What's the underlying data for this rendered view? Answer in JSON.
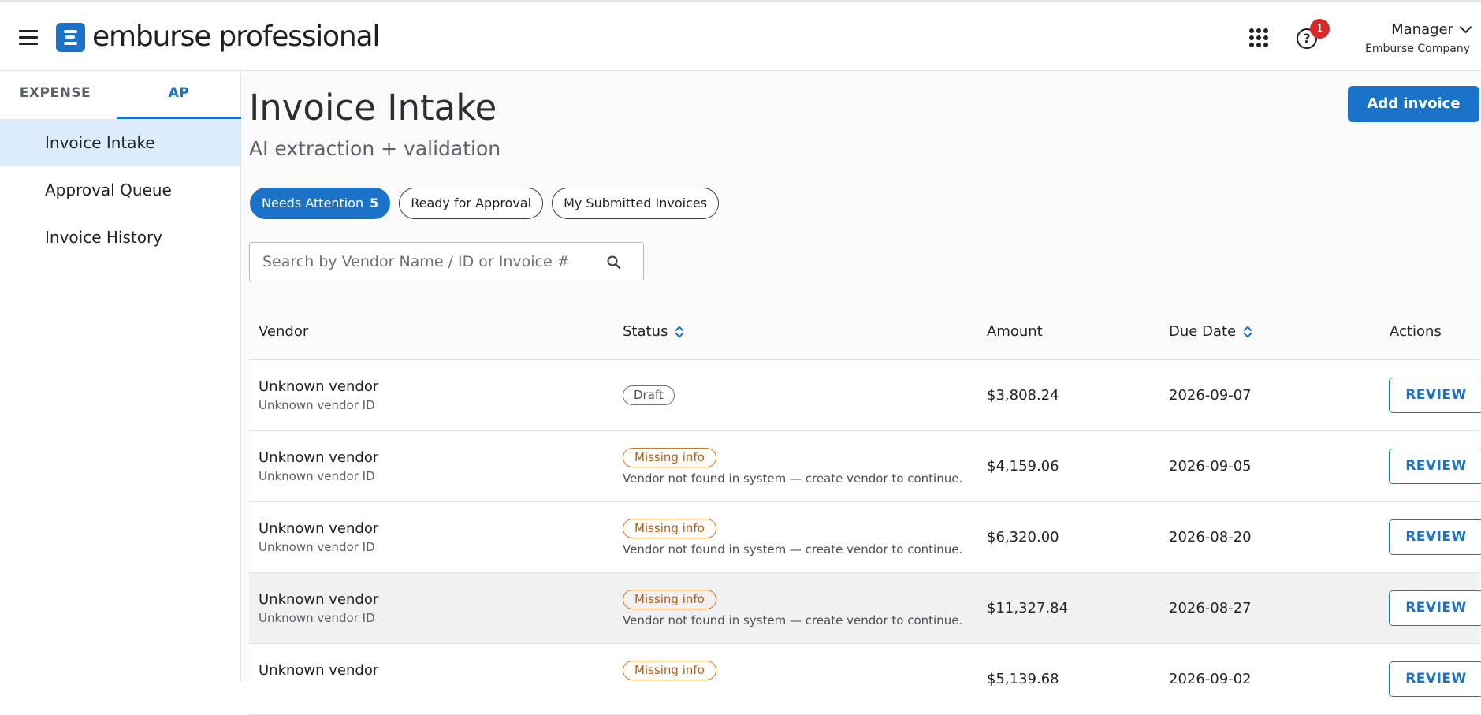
{
  "header": {
    "logo_text": "emburse professional",
    "help_badge_count": "1",
    "user_name": "Manager",
    "user_company": "Emburse Company",
    "help_icon": "help-icon",
    "apps_icon": "apps-grid-icon"
  },
  "sidebar": {
    "tabs": [
      {
        "label": "EXPENSE",
        "active": false
      },
      {
        "label": "AP",
        "active": true
      }
    ],
    "items": [
      {
        "label": "Invoice Intake",
        "active": true
      },
      {
        "label": "Approval Queue",
        "active": false
      },
      {
        "label": "Invoice History",
        "active": false
      }
    ]
  },
  "main": {
    "title": "Invoice Intake",
    "subtitle": "AI extraction + validation",
    "add_button": "Add invoice",
    "filters": [
      {
        "label": "Needs Attention",
        "count": "5",
        "active": true
      },
      {
        "label": "Ready for Approval",
        "active": false
      },
      {
        "label": "My Submitted Invoices",
        "active": false
      }
    ],
    "search": {
      "placeholder": "Search by Vendor Name / ID or Invoice #",
      "value": ""
    },
    "table": {
      "columns": [
        "Vendor",
        "Status",
        "Amount",
        "Due Date",
        "Actions"
      ],
      "rows": [
        {
          "vendor": "Unknown vendor",
          "vendor_id": "Unknown vendor ID",
          "status": "Draft",
          "note": "",
          "amount": "$3,808.24",
          "due": "2026-09-07",
          "action": "REVIEW"
        },
        {
          "vendor": "Unknown vendor",
          "vendor_id": "Unknown vendor ID",
          "status": "Missing info",
          "note": "Vendor not found in system — create vendor to continue.",
          "amount": "$4,159.06",
          "due": "2026-09-05",
          "action": "REVIEW"
        },
        {
          "vendor": "Unknown vendor",
          "vendor_id": "Unknown vendor ID",
          "status": "Missing info",
          "note": "Vendor not found in system — create vendor to continue.",
          "amount": "$6,320.00",
          "due": "2026-08-20",
          "action": "REVIEW"
        },
        {
          "vendor": "Unknown vendor",
          "vendor_id": "Unknown vendor ID",
          "status": "Missing info",
          "note": "Vendor not found in system — create vendor to continue.",
          "amount": "$11,327.84",
          "due": "2026-08-27",
          "action": "REVIEW"
        },
        {
          "vendor": "Unknown vendor",
          "vendor_id": "",
          "status": "Missing info",
          "note": "",
          "amount": "$5,139.68",
          "due": "2026-09-02",
          "action": "REVIEW"
        }
      ]
    }
  },
  "colors": {
    "accent": "#1a73c9",
    "active_nav_bg": "#dcecfa",
    "missing_badge": "#d4741f",
    "badge_red": "#d42a2a"
  }
}
